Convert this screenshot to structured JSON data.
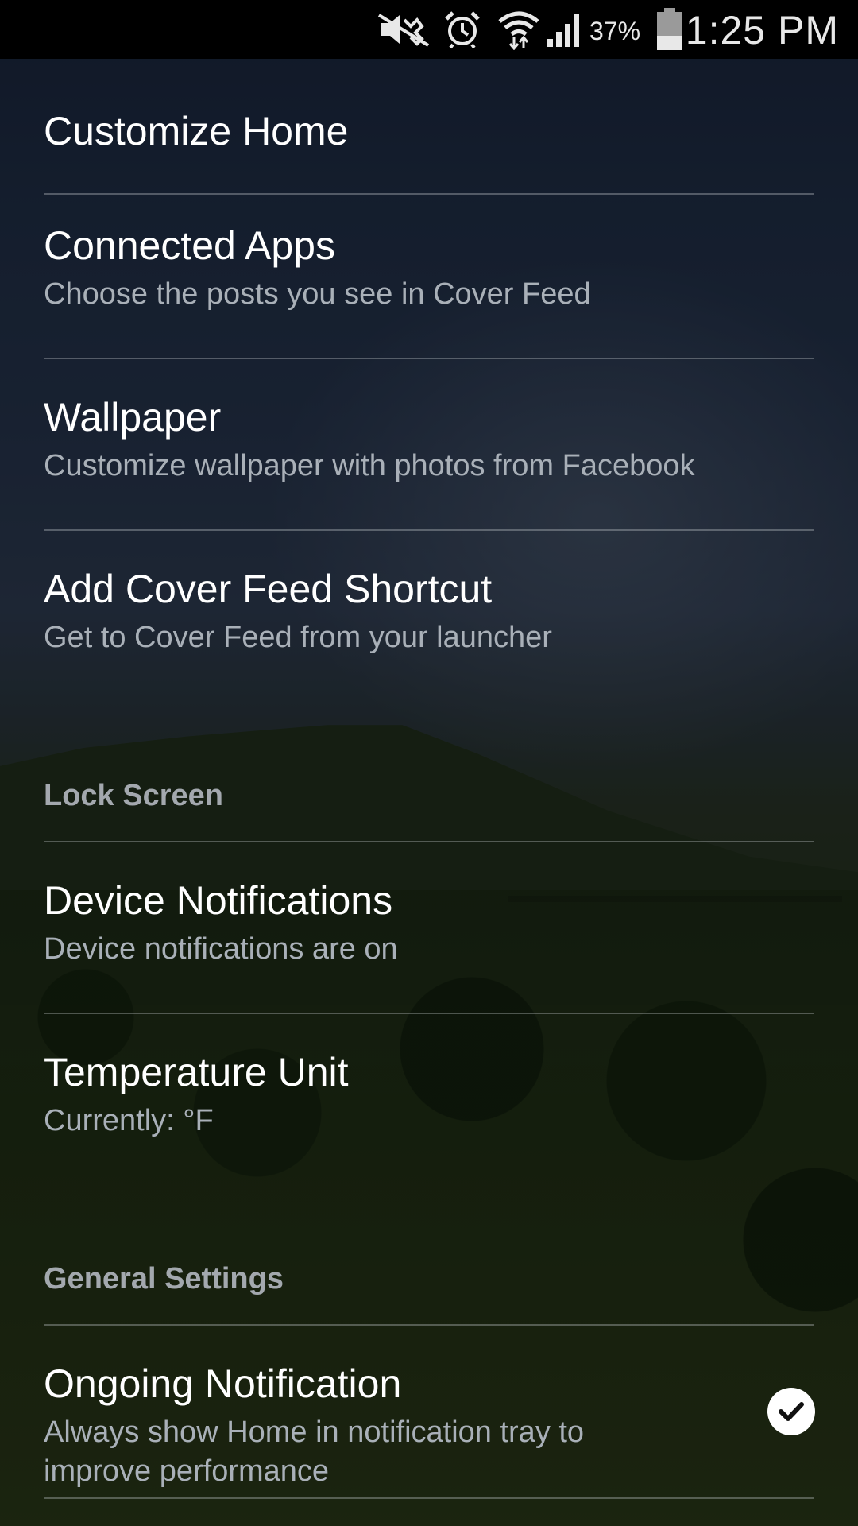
{
  "status_bar": {
    "battery_percent": "37%",
    "time": "1:25 PM",
    "icons": [
      "mute-icon",
      "alarm-icon",
      "wifi-icon",
      "signal-icon",
      "battery-icon"
    ]
  },
  "settings": {
    "customize_home": {
      "title": "Customize Home"
    },
    "connected_apps": {
      "title": "Connected Apps",
      "summary": "Choose the posts you see in Cover Feed"
    },
    "wallpaper": {
      "title": "Wallpaper",
      "summary": "Customize wallpaper with photos from Facebook"
    },
    "cover_feed_shortcut": {
      "title": "Add Cover Feed Shortcut",
      "summary": "Get to Cover Feed from your launcher"
    },
    "lock_screen_category": "Lock Screen",
    "device_notifications": {
      "title": "Device Notifications",
      "summary": "Device notifications are on"
    },
    "temperature_unit": {
      "title": "Temperature Unit",
      "summary": "Currently: °F"
    },
    "general_settings_category": "General Settings",
    "ongoing_notification": {
      "title": "Ongoing Notification",
      "summary": "Always show Home in notification tray to improve performance",
      "checked": true
    }
  },
  "colors": {
    "status_bar": "#000000",
    "title_text": "#ffffff",
    "summary_text": "#a9b0b8",
    "category_text": "#a3a8ae"
  }
}
